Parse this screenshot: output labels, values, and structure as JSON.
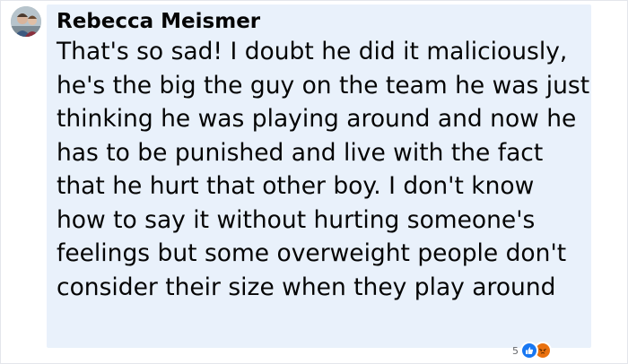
{
  "comment": {
    "author": "Rebecca Meismer",
    "text": "That's so sad! I doubt he did it maliciously, he's the big the guy on the team he was just thinking he was playing around and now he has to be punished and live with the fact that he hurt that other boy. I don't know how to say it without hurting someone's feelings but some overweight people don't consider their size when they play around",
    "reactions": {
      "count": "5",
      "types": [
        "like-icon",
        "angry-icon"
      ]
    }
  },
  "colors": {
    "bubble_background": "#e9f1fb",
    "text": "#050505",
    "like": "#1877f2",
    "angry": "#e9710f"
  }
}
